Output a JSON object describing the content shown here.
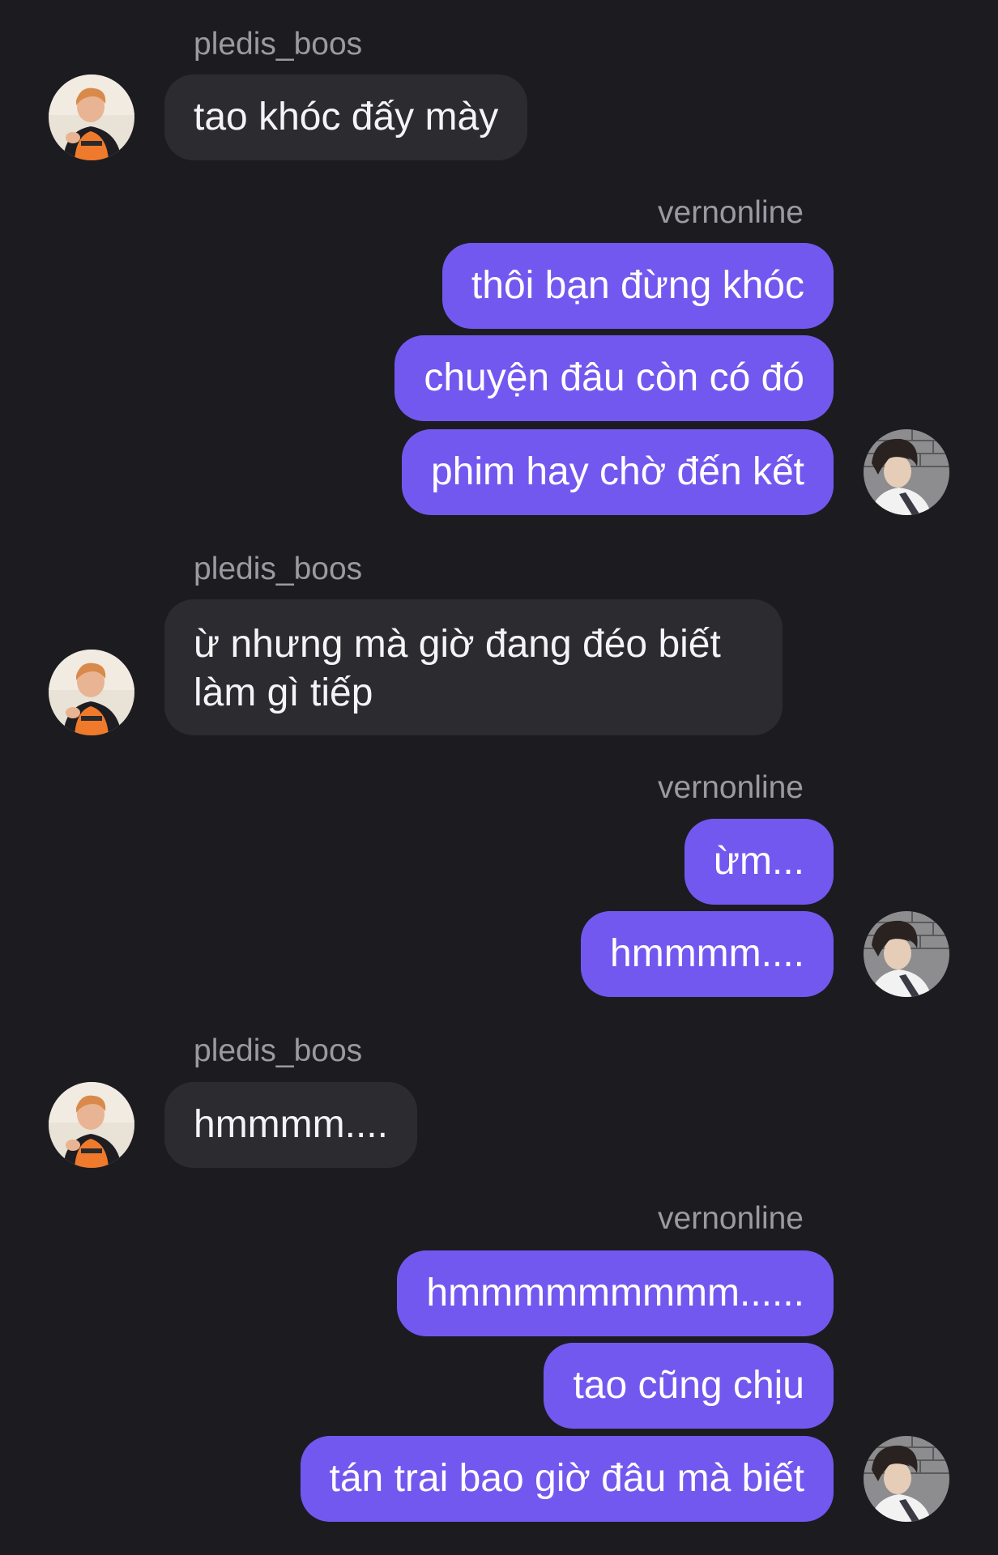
{
  "conversation": {
    "groups": [
      {
        "sender": "pledis_boos",
        "side": "in",
        "messages": [
          "tao khóc đấy mày"
        ]
      },
      {
        "sender": "vernonline",
        "side": "out",
        "messages": [
          "thôi bạn đừng khóc",
          "chuyện đâu còn có đó",
          "phim hay chờ đến kết"
        ]
      },
      {
        "sender": "pledis_boos",
        "side": "in",
        "messages": [
          "ừ nhưng mà giờ đang đéo biết làm gì tiếp"
        ]
      },
      {
        "sender": "vernonline",
        "side": "out",
        "messages": [
          "ừm...",
          "hmmmm...."
        ]
      },
      {
        "sender": "pledis_boos",
        "side": "in",
        "messages": [
          "hmmmm...."
        ]
      },
      {
        "sender": "vernonline",
        "side": "out",
        "messages": [
          "hmmmmmmmmm......",
          "tao cũng chịu",
          "tán trai bao giờ đâu mà biết"
        ]
      }
    ]
  },
  "colors": {
    "background": "#1c1c20",
    "incoming_bubble": "#2c2c30",
    "outgoing_bubble": "#7358f0",
    "sender_name": "#9a9aa2"
  },
  "icons": {
    "incoming_avatar": "user-avatar-icon",
    "outgoing_avatar": "user-avatar-icon"
  }
}
